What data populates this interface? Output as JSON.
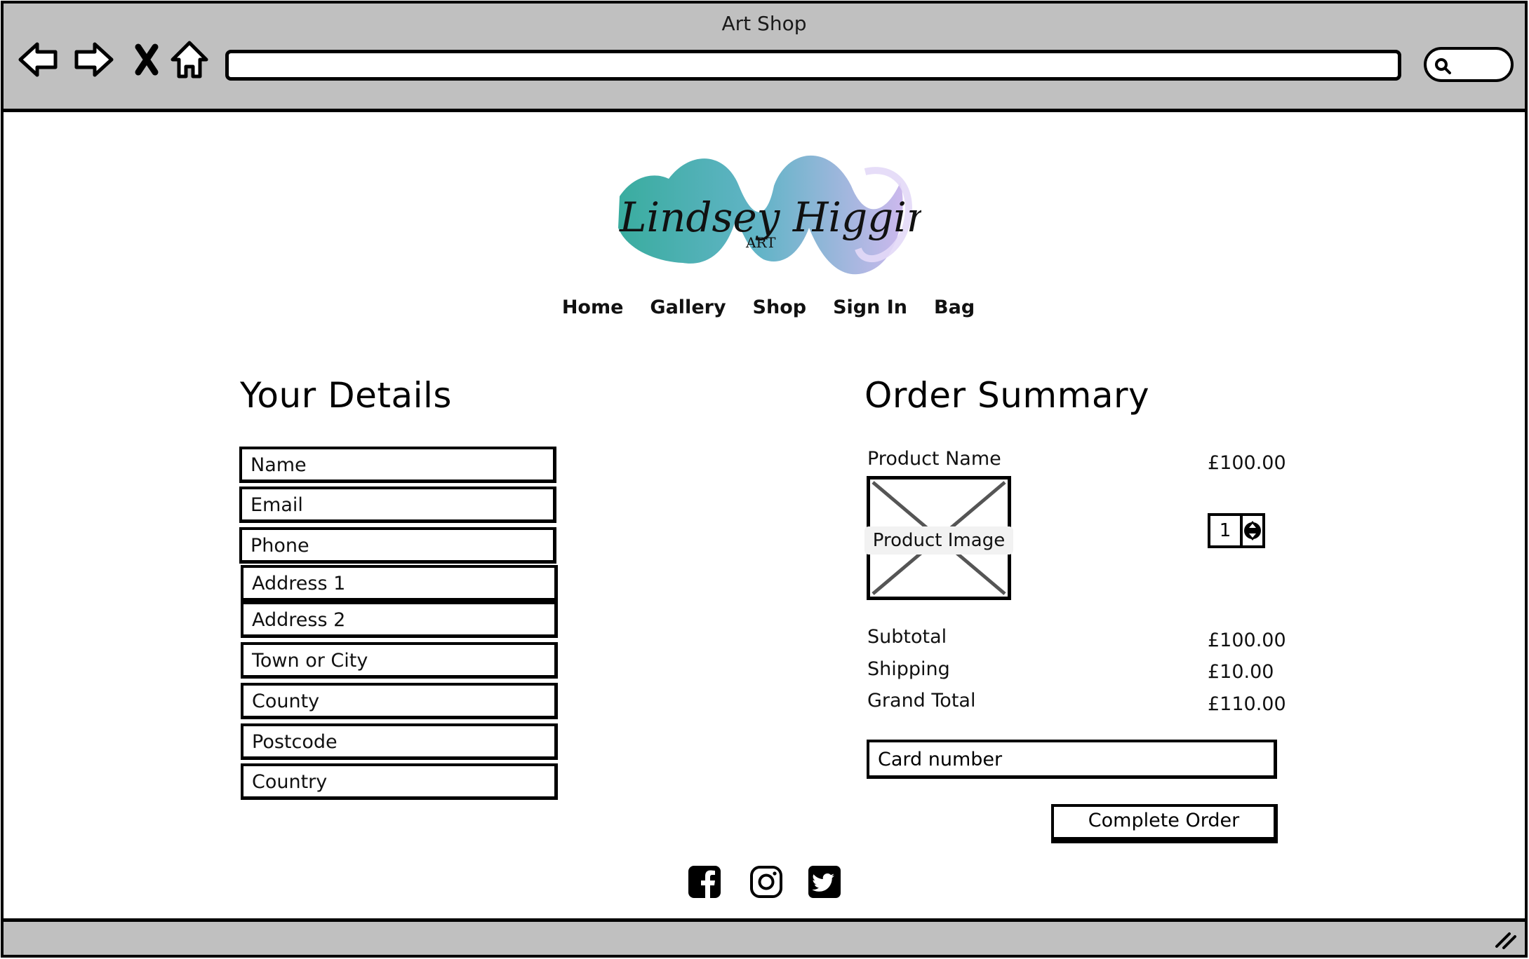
{
  "window": {
    "title": "Art Shop",
    "address": "",
    "search_value": ""
  },
  "icons": {
    "back": "back-arrow-icon",
    "forward": "forward-arrow-icon",
    "stop": "close-icon",
    "home": "home-icon",
    "search": "search-icon",
    "facebook": "facebook-icon",
    "instagram": "instagram-icon",
    "twitter": "twitter-icon"
  },
  "logo": {
    "script_text": "Lindsey Higginson",
    "sub_text": "ART"
  },
  "nav": {
    "items": [
      "Home",
      "Gallery",
      "Shop",
      "Sign In",
      "Bag"
    ]
  },
  "details": {
    "heading": "Your Details",
    "fields": [
      "Name",
      "Email",
      "Phone",
      "Address 1",
      "Address 2",
      "Town or City",
      "County",
      "Postcode",
      "Country"
    ]
  },
  "summary": {
    "heading": "Order Summary",
    "product_name": "Product Name",
    "product_price": "£100.00",
    "product_image_label": "Product Image",
    "quantity": "1",
    "subtotal_label": "Subtotal",
    "subtotal_value": "£100.00",
    "shipping_label": "Shipping",
    "shipping_value": "£10.00",
    "grand_total_label": "Grand Total",
    "grand_total_value": "£110.00",
    "card_placeholder": "Card number",
    "complete_button": "Complete Order"
  },
  "colors": {
    "chrome": "#c0c0c0",
    "logo_teal": "#2fa89a",
    "logo_lavender": "#b9a7e0"
  }
}
